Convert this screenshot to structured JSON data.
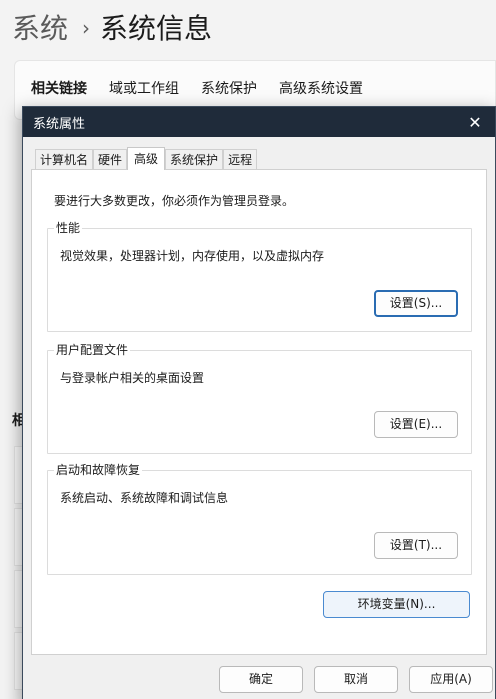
{
  "settings": {
    "breadcrumb_root": "系统",
    "breadcrumb_separator": "›",
    "page_title": "系统信息",
    "related_links": {
      "heading": "相关链接",
      "items": [
        "域或工作组",
        "系统保护",
        "高级系统设置"
      ]
    },
    "related_settings_fragment": "相"
  },
  "dialog": {
    "title": "系统属性",
    "close_glyph": "✕",
    "tabs": [
      "计算机名",
      "硬件",
      "高级",
      "系统保护",
      "远程"
    ],
    "active_tab": "高级",
    "admin_note": "要进行大多数更改，你必须作为管理员登录。",
    "groups": {
      "performance": {
        "title": "性能",
        "description": "视觉效果，处理器计划，内存使用，以及虚拟内存",
        "button": "设置(S)..."
      },
      "user_profiles": {
        "title": "用户配置文件",
        "description": "与登录帐户相关的桌面设置",
        "button": "设置(E)..."
      },
      "startup_recovery": {
        "title": "启动和故障恢复",
        "description": "系统启动、系统故障和调试信息",
        "button": "设置(T)..."
      }
    },
    "env_button": "环境变量(N)...",
    "footer": {
      "ok": "确定",
      "cancel": "取消",
      "apply": "应用(A)"
    }
  }
}
